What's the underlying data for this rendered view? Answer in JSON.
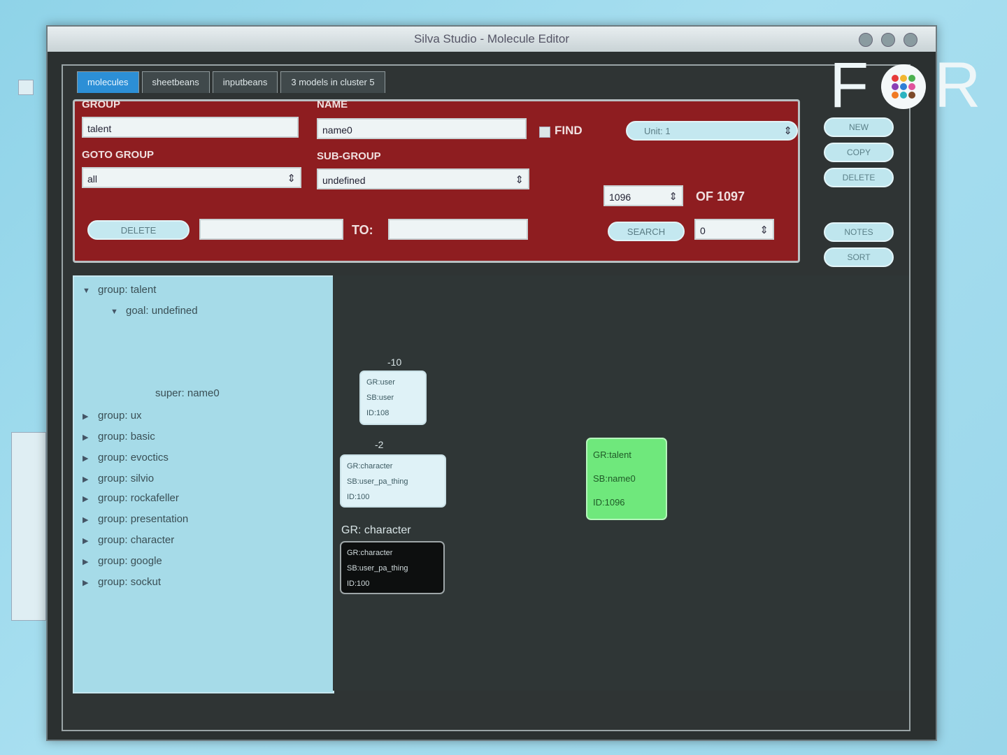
{
  "window": {
    "title": "Silva Studio - Molecule Editor"
  },
  "tabs": [
    {
      "label": "molecules",
      "active": true
    },
    {
      "label": "sheetbeans",
      "active": false
    },
    {
      "label": "inputbeans",
      "active": false
    },
    {
      "label": "3 models in cluster 5",
      "active": false
    }
  ],
  "panel": {
    "group_label": "GROUP",
    "group_value": "talent",
    "name_label": "NAME",
    "name_value": "name0",
    "find_label": "FIND",
    "find_select": "Unit: 1",
    "goto_group_label": "GOTO GROUP",
    "goto_group_value": "all",
    "subgroup_label": "SUB-GROUP",
    "subgroup_value": "undefined",
    "index_value": "1096",
    "of_total": "OF 1097",
    "delete_range_label": "DELETE",
    "from_value": "",
    "to_label": "TO:",
    "to_value": "",
    "search_label": "SEARCH",
    "search_value": "0"
  },
  "side_buttons": {
    "new": "NEW",
    "copy": "COPY",
    "delete": "DELETE",
    "notes": "NOTES",
    "sort": "SORT"
  },
  "tree": {
    "root": "group: talent",
    "child": "goal: undefined",
    "leaf": "super: name0",
    "groups": [
      "group: ux",
      "group: basic",
      "group: evoctics",
      "group: silvio",
      "group: rockafeller",
      "group: presentation",
      "group: character",
      "group: google",
      "group: sockut"
    ]
  },
  "canvas": {
    "node1": {
      "label": "-10",
      "lines": [
        "GR:user",
        "SB:user",
        "ID:108"
      ]
    },
    "node2": {
      "label": "-2",
      "lines": [
        "GR:character",
        "SB:user_pa_thing",
        "ID:100"
      ]
    },
    "node3": {
      "label": "GR: character",
      "lines": [
        "GR:character",
        "SB:user_pa_thing",
        "ID:100"
      ]
    },
    "node_selected": {
      "lines": [
        "GR:talent",
        "SB:name0",
        "ID:1096"
      ]
    }
  },
  "logo": {
    "text_left": "F",
    "text_right": "R"
  },
  "colors": {
    "panel_red": "#8e1d20",
    "tab_active": "#2c8fd6",
    "tree_bg": "#a6dbe8",
    "canvas_bg": "#2f3636",
    "selected_node": "#6fe87c"
  }
}
